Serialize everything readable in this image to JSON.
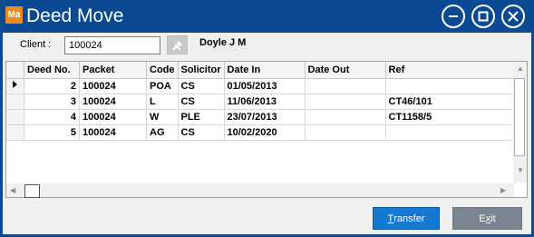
{
  "window": {
    "app_icon_text": "Ma",
    "title": "Deed Move"
  },
  "client": {
    "label": "Client :",
    "value": "100024",
    "name": "Doyle J M"
  },
  "grid": {
    "columns": [
      "Deed No.",
      "Packet",
      "Code",
      "Solicitor",
      "Date In",
      "Date Out",
      "Ref"
    ],
    "rows": [
      {
        "deed_no": "2",
        "packet": "100024",
        "code": "POA",
        "solicitor": "CS",
        "date_in": "01/05/2013",
        "date_out": "",
        "ref": ""
      },
      {
        "deed_no": "3",
        "packet": "100024",
        "code": "L",
        "solicitor": "CS",
        "date_in": "11/06/2013",
        "date_out": "",
        "ref": "CT46/101"
      },
      {
        "deed_no": "4",
        "packet": "100024",
        "code": "W",
        "solicitor": "PLE",
        "date_in": "23/07/2013",
        "date_out": "",
        "ref": "CT1158/5"
      },
      {
        "deed_no": "5",
        "packet": "100024",
        "code": "AG",
        "solicitor": "CS",
        "date_in": "10/02/2020",
        "date_out": "",
        "ref": ""
      }
    ]
  },
  "buttons": {
    "transfer_first": "T",
    "transfer_rest": "ransfer",
    "exit_pre": "E",
    "exit_underlined": "x",
    "exit_rest": "it"
  },
  "colors": {
    "titlebar": "#0b4a93",
    "transfer_button": "#1778d2",
    "exit_button": "#7a8591"
  }
}
